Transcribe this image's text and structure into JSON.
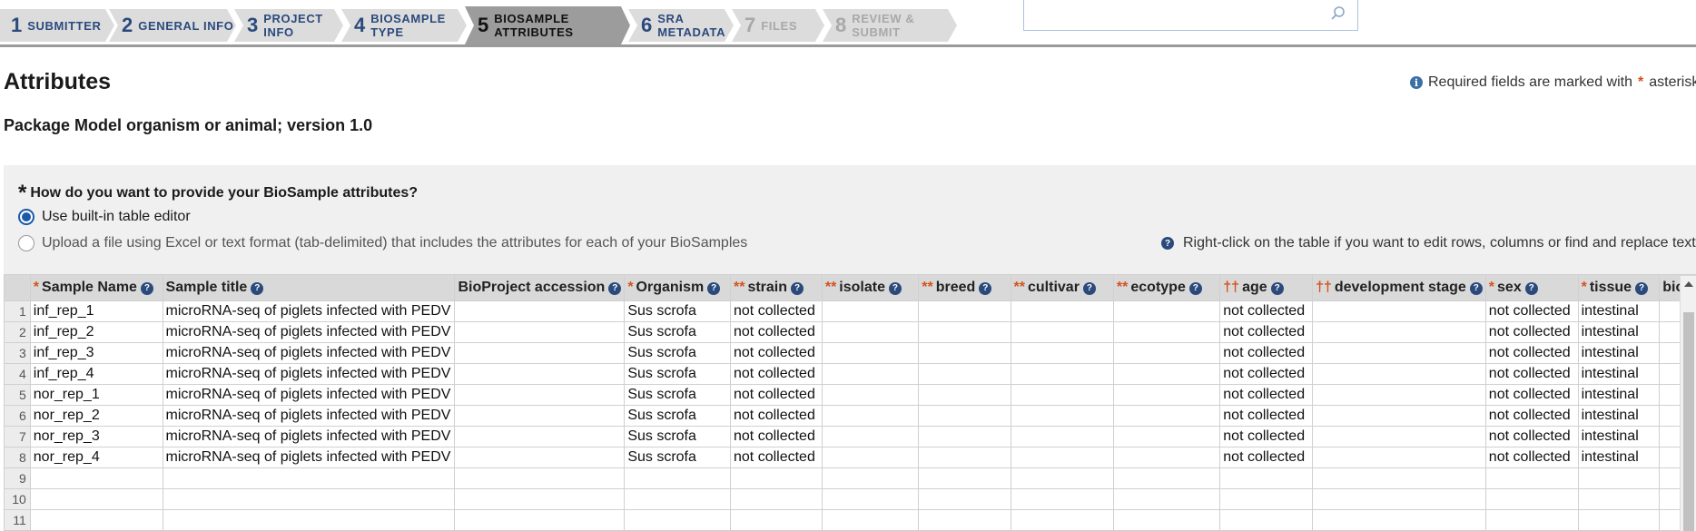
{
  "steps": [
    {
      "num": "1",
      "label": "SUBMITTER",
      "state": "done"
    },
    {
      "num": "2",
      "label": "GENERAL INFO",
      "state": "done"
    },
    {
      "num": "3",
      "label": "PROJECT INFO",
      "state": "done"
    },
    {
      "num": "4",
      "label": "BIOSAMPLE TYPE",
      "state": "done"
    },
    {
      "num": "5",
      "label": "BIOSAMPLE ATTRIBUTES",
      "state": "active"
    },
    {
      "num": "6",
      "label": "SRA METADATA",
      "state": "done"
    },
    {
      "num": "7",
      "label": "FILES",
      "state": "disabled"
    },
    {
      "num": "8",
      "label": "REVIEW & SUBMIT",
      "state": "disabled"
    }
  ],
  "page": {
    "title": "Attributes",
    "required_note": "Required fields are marked with",
    "required_note_tail": "asterisk",
    "package": "Package Model organism or animal; version 1.0"
  },
  "panel": {
    "question": "How do you want to provide your BioSample attributes?",
    "option_table": "Use built-in table editor",
    "option_upload": "Upload a file using Excel or text format (tab-delimited) that includes the attributes for each of your BioSamples",
    "hint": "Right-click on the table if you want to edit rows, columns or find and replace text"
  },
  "colors": {
    "accent": "#2b4a7c",
    "asterisk": "#d4521d",
    "active_step": "#9c9c9c"
  },
  "table": {
    "columns": [
      {
        "label": "Sample Name",
        "marker": "*",
        "help": true
      },
      {
        "label": "Sample title",
        "marker": "",
        "help": true
      },
      {
        "label": "BioProject accession",
        "marker": "",
        "help": true
      },
      {
        "label": "Organism",
        "marker": "*",
        "help": true
      },
      {
        "label": "strain",
        "marker": "**",
        "help": true
      },
      {
        "label": "isolate",
        "marker": "**",
        "help": true
      },
      {
        "label": "breed",
        "marker": "**",
        "help": true
      },
      {
        "label": "cultivar",
        "marker": "**",
        "help": true
      },
      {
        "label": "ecotype",
        "marker": "**",
        "help": true
      },
      {
        "label": "age",
        "marker": "††",
        "help": true
      },
      {
        "label": "development stage",
        "marker": "††",
        "help": true
      },
      {
        "label": "sex",
        "marker": "*",
        "help": true
      },
      {
        "label": "tissue",
        "marker": "*",
        "help": true
      },
      {
        "label": "bio",
        "marker": "",
        "help": false
      }
    ],
    "rows": [
      [
        "inf_rep_1",
        "microRNA-seq of piglets infected with PEDV",
        "",
        "Sus scrofa",
        "not collected",
        "",
        "",
        "",
        "",
        "not collected",
        "",
        "not collected",
        "intestinal",
        ""
      ],
      [
        "inf_rep_2",
        "microRNA-seq of piglets infected with PEDV",
        "",
        "Sus scrofa",
        "not collected",
        "",
        "",
        "",
        "",
        "not collected",
        "",
        "not collected",
        "intestinal",
        ""
      ],
      [
        "inf_rep_3",
        "microRNA-seq of piglets infected with PEDV",
        "",
        "Sus scrofa",
        "not collected",
        "",
        "",
        "",
        "",
        "not collected",
        "",
        "not collected",
        "intestinal",
        ""
      ],
      [
        "inf_rep_4",
        "microRNA-seq of piglets infected with PEDV",
        "",
        "Sus scrofa",
        "not collected",
        "",
        "",
        "",
        "",
        "not collected",
        "",
        "not collected",
        "intestinal",
        ""
      ],
      [
        "nor_rep_1",
        "microRNA-seq of piglets infected with PEDV",
        "",
        "Sus scrofa",
        "not collected",
        "",
        "",
        "",
        "",
        "not collected",
        "",
        "not collected",
        "intestinal",
        ""
      ],
      [
        "nor_rep_2",
        "microRNA-seq of piglets infected with PEDV",
        "",
        "Sus scrofa",
        "not collected",
        "",
        "",
        "",
        "",
        "not collected",
        "",
        "not collected",
        "intestinal",
        ""
      ],
      [
        "nor_rep_3",
        "microRNA-seq of piglets infected with PEDV",
        "",
        "Sus scrofa",
        "not collected",
        "",
        "",
        "",
        "",
        "not collected",
        "",
        "not collected",
        "intestinal",
        ""
      ],
      [
        "nor_rep_4",
        "microRNA-seq of piglets infected with PEDV",
        "",
        "Sus scrofa",
        "not collected",
        "",
        "",
        "",
        "",
        "not collected",
        "",
        "not collected",
        "intestinal",
        ""
      ],
      [
        "",
        "",
        "",
        "",
        "",
        "",
        "",
        "",
        "",
        "",
        "",
        "",
        "",
        ""
      ],
      [
        "",
        "",
        "",
        "",
        "",
        "",
        "",
        "",
        "",
        "",
        "",
        "",
        "",
        ""
      ],
      [
        "",
        "",
        "",
        "",
        "",
        "",
        "",
        "",
        "",
        "",
        "",
        "",
        "",
        ""
      ]
    ]
  }
}
